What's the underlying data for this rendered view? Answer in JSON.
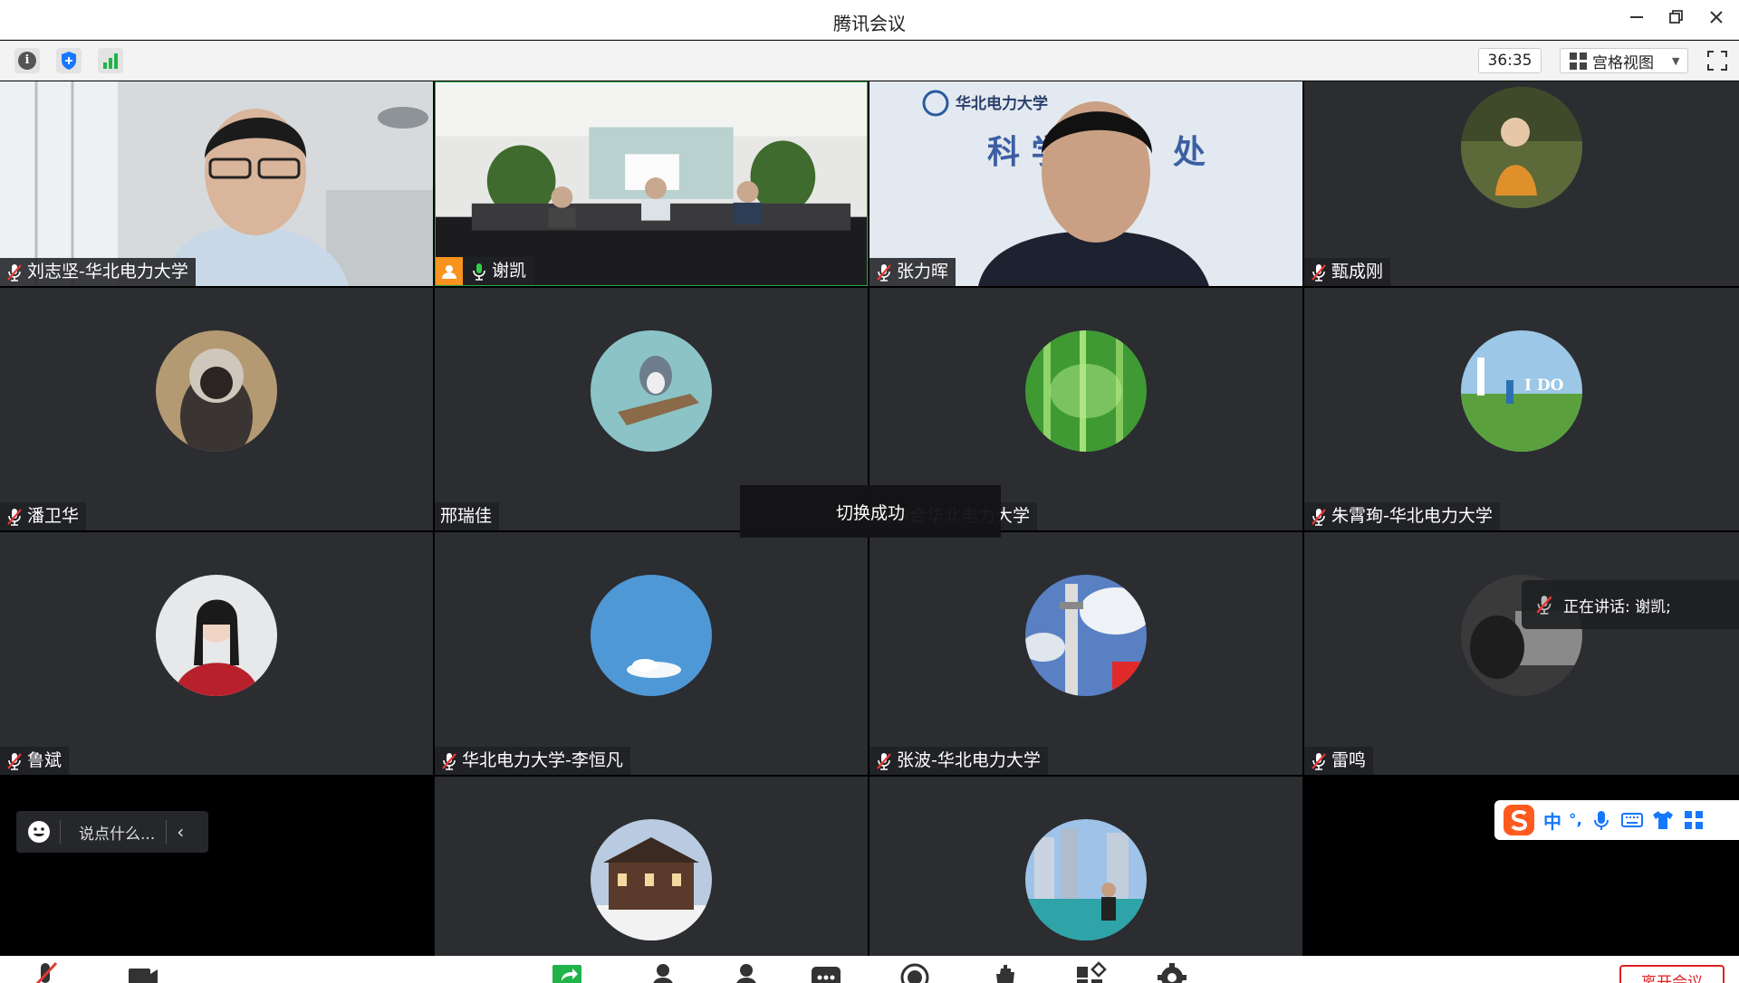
{
  "app": {
    "title": "腾讯会议"
  },
  "toolbar": {
    "timer": "36:35",
    "view_label": "宫格视图"
  },
  "participants": [
    {
      "name": "刘志坚-华北电力大学",
      "muted": true
    },
    {
      "name": "谢凯",
      "muted": false,
      "host": true,
      "speaking": true
    },
    {
      "name": "张力晖",
      "muted": true
    },
    {
      "name": "甄成刚",
      "muted": true
    },
    {
      "name": "潘卫华",
      "muted": true
    },
    {
      "name": "邢瑞佳",
      "muted": false
    },
    {
      "name": "雨中合华北电力大学",
      "muted": false
    },
    {
      "name": "朱霄珣-华北电力大学",
      "muted": true
    },
    {
      "name": "鲁斌",
      "muted": true
    },
    {
      "name": "华北电力大学-李恒凡",
      "muted": true
    },
    {
      "name": "张波-华北电力大学",
      "muted": true
    },
    {
      "name": "雷鸣",
      "muted": true
    }
  ],
  "video_tile_3": {
    "banner_text": "华北电力大学",
    "wall_text": "科 学",
    "wall_text_2": "处"
  },
  "avatar_8": {
    "overlay_text": "I DO"
  },
  "toast": {
    "text": "切换成功"
  },
  "speaking_indicator": {
    "text": "正在讲话: 谢凯;"
  },
  "chat": {
    "placeholder": "说点什么..."
  },
  "ime": {
    "mode_label": "中",
    "punct_label": "°,"
  },
  "controls": {
    "end_label": "离开会议"
  },
  "colors": {
    "tile_bg": "#2b2d31",
    "host_badge": "#f7931e",
    "speaking_border": "#27a844",
    "mic_active": "#2fcf4a",
    "end_red": "#e02020",
    "ime_blue": "#1677ff"
  }
}
